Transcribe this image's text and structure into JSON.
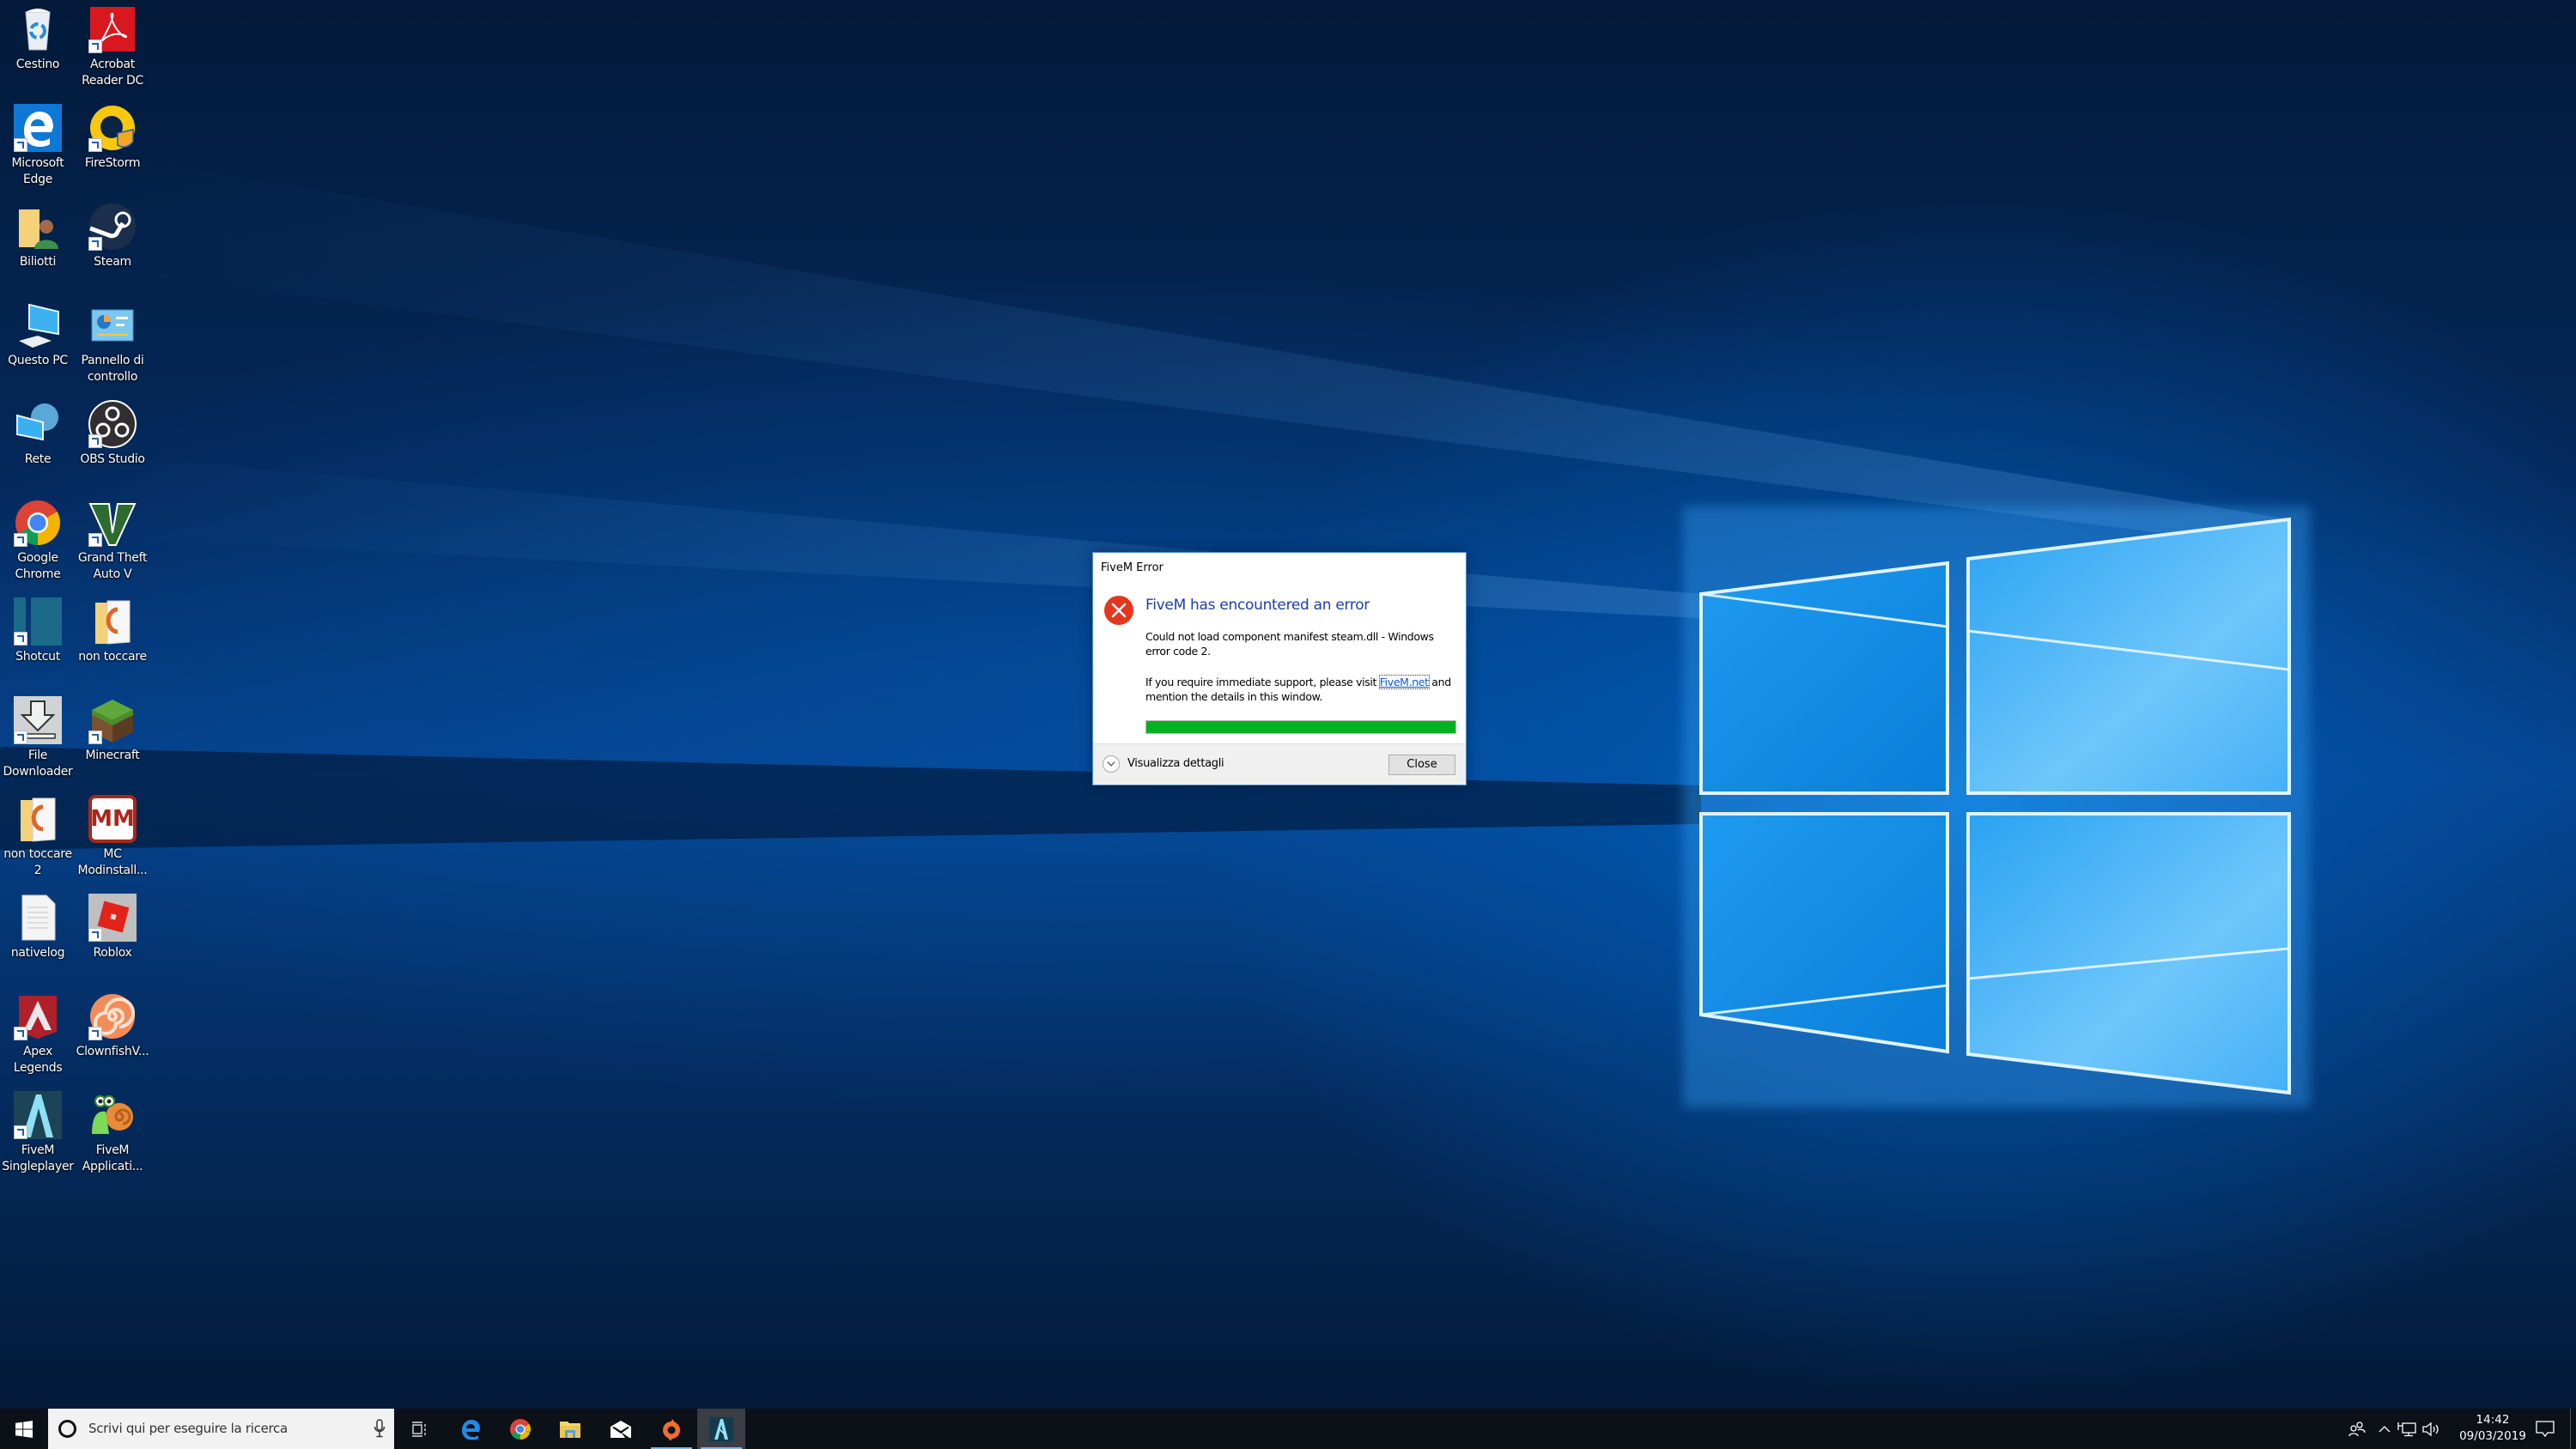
{
  "desktop": {
    "icons": [
      {
        "label": "Cestino",
        "icon": "recycle-bin-icon",
        "shortcut": false
      },
      {
        "label": "Acrobat\nReader DC",
        "icon": "acrobat-reader-icon",
        "shortcut": true
      },
      {
        "label": "Microsoft\nEdge",
        "icon": "edge-icon",
        "shortcut": true
      },
      {
        "label": "FireStorm",
        "icon": "firestorm-icon",
        "shortcut": true
      },
      {
        "label": "Biliotti",
        "icon": "user-folder-icon",
        "shortcut": false
      },
      {
        "label": "Steam",
        "icon": "steam-icon",
        "shortcut": true
      },
      {
        "label": "Questo PC",
        "icon": "computer-icon",
        "shortcut": false
      },
      {
        "label": "Pannello di\ncontrollo",
        "icon": "control-panel-icon",
        "shortcut": false
      },
      {
        "label": "Rete",
        "icon": "network-icon",
        "shortcut": false
      },
      {
        "label": "OBS Studio",
        "icon": "obs-icon",
        "shortcut": true
      },
      {
        "label": "Google\nChrome",
        "icon": "chrome-icon",
        "shortcut": true
      },
      {
        "label": "Grand Theft\nAuto V",
        "icon": "gta-v-icon",
        "shortcut": true
      },
      {
        "label": "Shotcut",
        "icon": "shotcut-icon",
        "shortcut": true
      },
      {
        "label": "non toccare",
        "icon": "folder-icon",
        "shortcut": false
      },
      {
        "label": "File\nDownloader",
        "icon": "file-downloader-icon",
        "shortcut": true
      },
      {
        "label": "Minecraft",
        "icon": "minecraft-icon",
        "shortcut": true
      },
      {
        "label": "non toccare 2",
        "icon": "folder-icon",
        "shortcut": false
      },
      {
        "label": "MC\nModinstall...",
        "icon": "mc-modinstaller-icon",
        "shortcut": false
      },
      {
        "label": "nativelog",
        "icon": "text-file-icon",
        "shortcut": false
      },
      {
        "label": "Roblox",
        "icon": "roblox-icon",
        "shortcut": true
      },
      {
        "label": "Apex\nLegends",
        "icon": "apex-legends-icon",
        "shortcut": true
      },
      {
        "label": "ClownfishV...",
        "icon": "clownfish-icon",
        "shortcut": true
      },
      {
        "label": "FiveM\nSingleplayer",
        "icon": "fivem-singleplayer-icon",
        "shortcut": true
      },
      {
        "label": "FiveM\nApplicati...",
        "icon": "fivem-application-icon",
        "shortcut": false
      }
    ]
  },
  "dialog": {
    "title": "FiveM Error",
    "heading": "FiveM has encountered an error",
    "message": "Could not load component manifest steam.dll - Windows error code 2.",
    "support_prefix": "If you require immediate support, please visit ",
    "support_link": "FiveM.net",
    "support_suffix": " and mention the details in this window.",
    "progress": 1.0,
    "details_label": "Visualizza dettagli",
    "close_label": "Close",
    "colors": {
      "heading": "#1c3fa3",
      "progress": "#06b025",
      "error": "#e3371e"
    }
  },
  "taskbar": {
    "search_placeholder": "Scrivi qui per eseguire la ricerca",
    "pinned": [
      {
        "name": "task-view",
        "running": false,
        "active": false
      },
      {
        "name": "edge",
        "running": false,
        "active": false
      },
      {
        "name": "chrome",
        "running": false,
        "active": false
      },
      {
        "name": "file-explorer",
        "running": false,
        "active": false
      },
      {
        "name": "mail",
        "running": false,
        "active": false
      },
      {
        "name": "origin",
        "running": true,
        "active": false
      },
      {
        "name": "fivem",
        "running": true,
        "active": true
      }
    ],
    "clock": {
      "time": "14:42",
      "date": "09/03/2019"
    }
  }
}
